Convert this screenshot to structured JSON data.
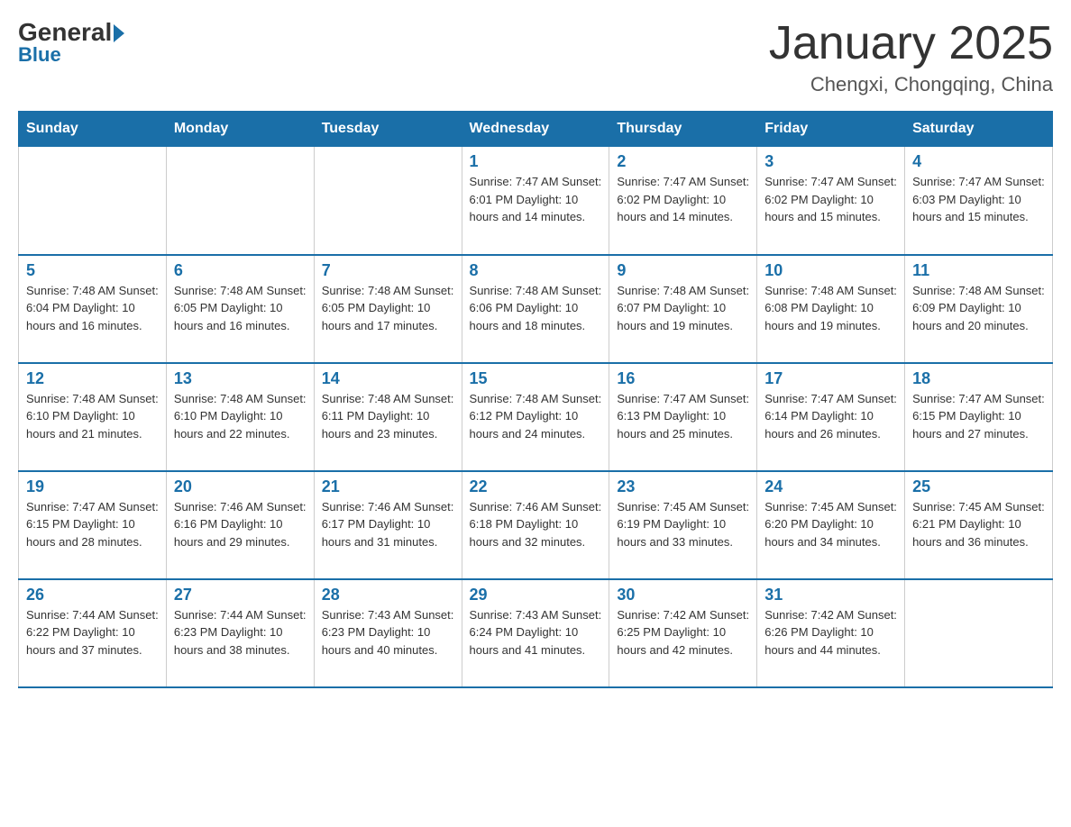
{
  "logo": {
    "general": "General",
    "blue": "Blue"
  },
  "header": {
    "month": "January 2025",
    "location": "Chengxi, Chongqing, China"
  },
  "weekdays": [
    "Sunday",
    "Monday",
    "Tuesday",
    "Wednesday",
    "Thursday",
    "Friday",
    "Saturday"
  ],
  "weeks": [
    [
      {
        "day": "",
        "info": ""
      },
      {
        "day": "",
        "info": ""
      },
      {
        "day": "",
        "info": ""
      },
      {
        "day": "1",
        "info": "Sunrise: 7:47 AM\nSunset: 6:01 PM\nDaylight: 10 hours\nand 14 minutes."
      },
      {
        "day": "2",
        "info": "Sunrise: 7:47 AM\nSunset: 6:02 PM\nDaylight: 10 hours\nand 14 minutes."
      },
      {
        "day": "3",
        "info": "Sunrise: 7:47 AM\nSunset: 6:02 PM\nDaylight: 10 hours\nand 15 minutes."
      },
      {
        "day": "4",
        "info": "Sunrise: 7:47 AM\nSunset: 6:03 PM\nDaylight: 10 hours\nand 15 minutes."
      }
    ],
    [
      {
        "day": "5",
        "info": "Sunrise: 7:48 AM\nSunset: 6:04 PM\nDaylight: 10 hours\nand 16 minutes."
      },
      {
        "day": "6",
        "info": "Sunrise: 7:48 AM\nSunset: 6:05 PM\nDaylight: 10 hours\nand 16 minutes."
      },
      {
        "day": "7",
        "info": "Sunrise: 7:48 AM\nSunset: 6:05 PM\nDaylight: 10 hours\nand 17 minutes."
      },
      {
        "day": "8",
        "info": "Sunrise: 7:48 AM\nSunset: 6:06 PM\nDaylight: 10 hours\nand 18 minutes."
      },
      {
        "day": "9",
        "info": "Sunrise: 7:48 AM\nSunset: 6:07 PM\nDaylight: 10 hours\nand 19 minutes."
      },
      {
        "day": "10",
        "info": "Sunrise: 7:48 AM\nSunset: 6:08 PM\nDaylight: 10 hours\nand 19 minutes."
      },
      {
        "day": "11",
        "info": "Sunrise: 7:48 AM\nSunset: 6:09 PM\nDaylight: 10 hours\nand 20 minutes."
      }
    ],
    [
      {
        "day": "12",
        "info": "Sunrise: 7:48 AM\nSunset: 6:10 PM\nDaylight: 10 hours\nand 21 minutes."
      },
      {
        "day": "13",
        "info": "Sunrise: 7:48 AM\nSunset: 6:10 PM\nDaylight: 10 hours\nand 22 minutes."
      },
      {
        "day": "14",
        "info": "Sunrise: 7:48 AM\nSunset: 6:11 PM\nDaylight: 10 hours\nand 23 minutes."
      },
      {
        "day": "15",
        "info": "Sunrise: 7:48 AM\nSunset: 6:12 PM\nDaylight: 10 hours\nand 24 minutes."
      },
      {
        "day": "16",
        "info": "Sunrise: 7:47 AM\nSunset: 6:13 PM\nDaylight: 10 hours\nand 25 minutes."
      },
      {
        "day": "17",
        "info": "Sunrise: 7:47 AM\nSunset: 6:14 PM\nDaylight: 10 hours\nand 26 minutes."
      },
      {
        "day": "18",
        "info": "Sunrise: 7:47 AM\nSunset: 6:15 PM\nDaylight: 10 hours\nand 27 minutes."
      }
    ],
    [
      {
        "day": "19",
        "info": "Sunrise: 7:47 AM\nSunset: 6:15 PM\nDaylight: 10 hours\nand 28 minutes."
      },
      {
        "day": "20",
        "info": "Sunrise: 7:46 AM\nSunset: 6:16 PM\nDaylight: 10 hours\nand 29 minutes."
      },
      {
        "day": "21",
        "info": "Sunrise: 7:46 AM\nSunset: 6:17 PM\nDaylight: 10 hours\nand 31 minutes."
      },
      {
        "day": "22",
        "info": "Sunrise: 7:46 AM\nSunset: 6:18 PM\nDaylight: 10 hours\nand 32 minutes."
      },
      {
        "day": "23",
        "info": "Sunrise: 7:45 AM\nSunset: 6:19 PM\nDaylight: 10 hours\nand 33 minutes."
      },
      {
        "day": "24",
        "info": "Sunrise: 7:45 AM\nSunset: 6:20 PM\nDaylight: 10 hours\nand 34 minutes."
      },
      {
        "day": "25",
        "info": "Sunrise: 7:45 AM\nSunset: 6:21 PM\nDaylight: 10 hours\nand 36 minutes."
      }
    ],
    [
      {
        "day": "26",
        "info": "Sunrise: 7:44 AM\nSunset: 6:22 PM\nDaylight: 10 hours\nand 37 minutes."
      },
      {
        "day": "27",
        "info": "Sunrise: 7:44 AM\nSunset: 6:23 PM\nDaylight: 10 hours\nand 38 minutes."
      },
      {
        "day": "28",
        "info": "Sunrise: 7:43 AM\nSunset: 6:23 PM\nDaylight: 10 hours\nand 40 minutes."
      },
      {
        "day": "29",
        "info": "Sunrise: 7:43 AM\nSunset: 6:24 PM\nDaylight: 10 hours\nand 41 minutes."
      },
      {
        "day": "30",
        "info": "Sunrise: 7:42 AM\nSunset: 6:25 PM\nDaylight: 10 hours\nand 42 minutes."
      },
      {
        "day": "31",
        "info": "Sunrise: 7:42 AM\nSunset: 6:26 PM\nDaylight: 10 hours\nand 44 minutes."
      },
      {
        "day": "",
        "info": ""
      }
    ]
  ]
}
